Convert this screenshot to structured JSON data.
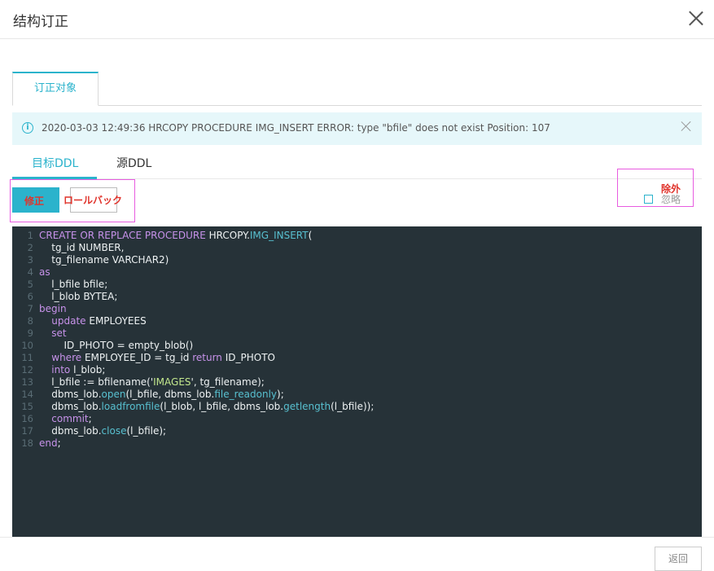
{
  "dialog": {
    "title": "结构订正"
  },
  "outer_tab": {
    "label": "订正对象"
  },
  "alert": {
    "message": "2020-03-03 12:49:36 HRCOPY PROCEDURE IMG_INSERT ERROR: type \"bfile\" does not exist Position: 107"
  },
  "inner_tabs": [
    {
      "label": "目标DDL"
    },
    {
      "label": "源DDL"
    }
  ],
  "toolbar": {
    "fix_label": "修正",
    "rollback_label": "ロールバック",
    "exclude_label": "除外",
    "ignore_label": "忽略"
  },
  "code_lines": [
    {
      "n": "1",
      "text": "CREATE OR REPLACE PROCEDURE HRCOPY.IMG_INSERT("
    },
    {
      "n": "2",
      "text": "    tg_id NUMBER,"
    },
    {
      "n": "3",
      "text": "    tg_filename VARCHAR2)"
    },
    {
      "n": "4",
      "text": "as"
    },
    {
      "n": "5",
      "text": "    l_bfile bfile;"
    },
    {
      "n": "6",
      "text": "    l_blob BYTEA;"
    },
    {
      "n": "7",
      "text": "begin"
    },
    {
      "n": "8",
      "text": "    update EMPLOYEES"
    },
    {
      "n": "9",
      "text": "    set"
    },
    {
      "n": "10",
      "text": "        ID_PHOTO = empty_blob()"
    },
    {
      "n": "11",
      "text": "    where EMPLOYEE_ID = tg_id return ID_PHOTO"
    },
    {
      "n": "12",
      "text": "    into l_blob;"
    },
    {
      "n": "13",
      "text": "    l_bfile := bfilename('IMAGES', tg_filename);"
    },
    {
      "n": "14",
      "text": "    dbms_lob.open(l_bfile, dbms_lob.file_readonly);"
    },
    {
      "n": "15",
      "text": "    dbms_lob.loadfromfile(l_blob, l_bfile, dbms_lob.getlength(l_bfile));"
    },
    {
      "n": "16",
      "text": "    commit;"
    },
    {
      "n": "17",
      "text": "    dbms_lob.close(l_bfile);"
    },
    {
      "n": "18",
      "text": "end;"
    }
  ],
  "footer": {
    "back_label": "返回"
  },
  "colors": {
    "accent": "#2bb3cc",
    "editor_bg": "#263238",
    "keyword": "#c792ea",
    "function": "#58c0d0",
    "string": "#c3e88d",
    "annotation_red": "#e0332b",
    "annotation_box": "#e85ce0"
  }
}
